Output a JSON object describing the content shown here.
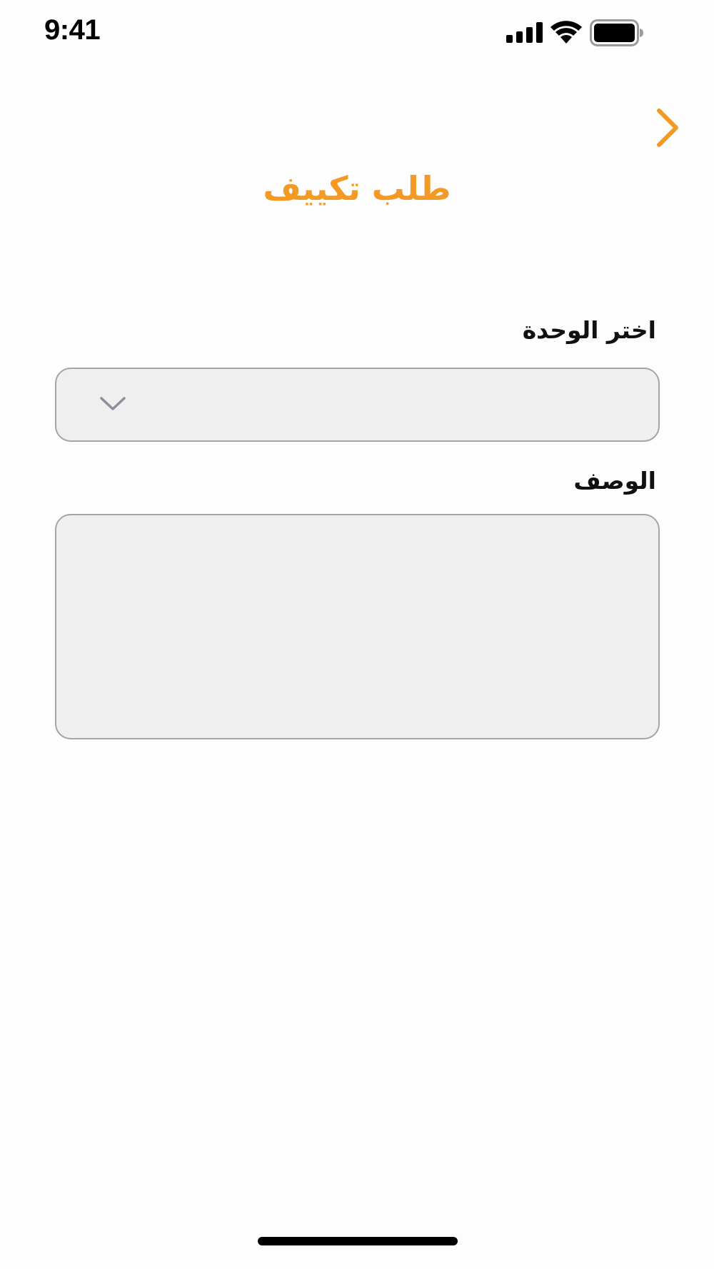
{
  "status_bar": {
    "time": "9:41",
    "icons": [
      "cellular-signal-icon",
      "wifi-icon",
      "battery-icon"
    ]
  },
  "nav": {
    "back_icon": "chevron-right-icon"
  },
  "page": {
    "title": "طلب تكييف"
  },
  "form": {
    "unit_select": {
      "label": "اختر الوحدة",
      "value": "",
      "icon": "chevron-down-icon"
    },
    "description": {
      "label": "الوصف",
      "value": ""
    }
  },
  "colors": {
    "accent": "#f29a25",
    "field_background": "#efefef",
    "field_border": "#a3a5ac",
    "page_background": "#fdfdfd",
    "text": "#111111"
  }
}
